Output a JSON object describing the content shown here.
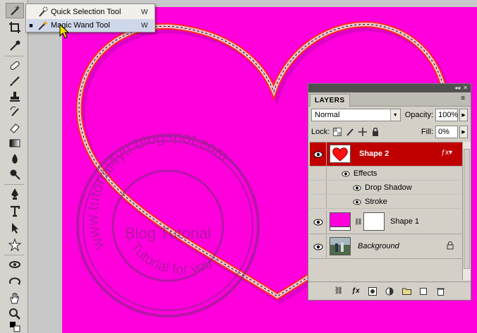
{
  "colors": {
    "canvas_bg": "#ff00dd",
    "heart_stroke": "#ff2a1a",
    "selected_layer": "#c00000",
    "watermark": "#7a2a7a"
  },
  "toolbox": {
    "tools": [
      "magic-wand-icon",
      "crop-icon",
      "eyedropper-icon",
      "healing-brush-icon",
      "brush-icon",
      "clone-stamp-icon",
      "history-brush-icon",
      "eraser-icon",
      "gradient-icon",
      "blur-icon",
      "dodge-icon",
      "pen-icon",
      "type-icon",
      "path-selection-icon",
      "custom-shape-icon",
      "3d-rotate-icon",
      "3d-orbit-icon",
      "hand-icon",
      "zoom-icon",
      "color-swatches-icon"
    ]
  },
  "flyout": {
    "items": [
      {
        "label": "Quick Selection Tool",
        "shortcut": "W",
        "active": false
      },
      {
        "label": "Magic Wand Tool",
        "shortcut": "W",
        "active": true
      }
    ]
  },
  "watermark": {
    "outer_text": "www.tutorial4yu.blogspot.com",
    "bottom_text": "- Tutorial for you -",
    "center_text": "Blog Tutorial"
  },
  "layers_panel": {
    "tab_label": "LAYERS",
    "blend_mode": "Normal",
    "opacity_label": "Opacity:",
    "opacity_value": "100%",
    "lock_label": "Lock:",
    "fill_label": "Fill:",
    "fill_value": "0%",
    "layers": [
      {
        "name": "Shape 2",
        "selected": true
      },
      {
        "name": "Shape 1",
        "selected": false
      },
      {
        "name": "Background",
        "selected": false
      }
    ],
    "effects_label": "Effects",
    "effects": [
      "Drop Shadow",
      "Stroke"
    ]
  }
}
